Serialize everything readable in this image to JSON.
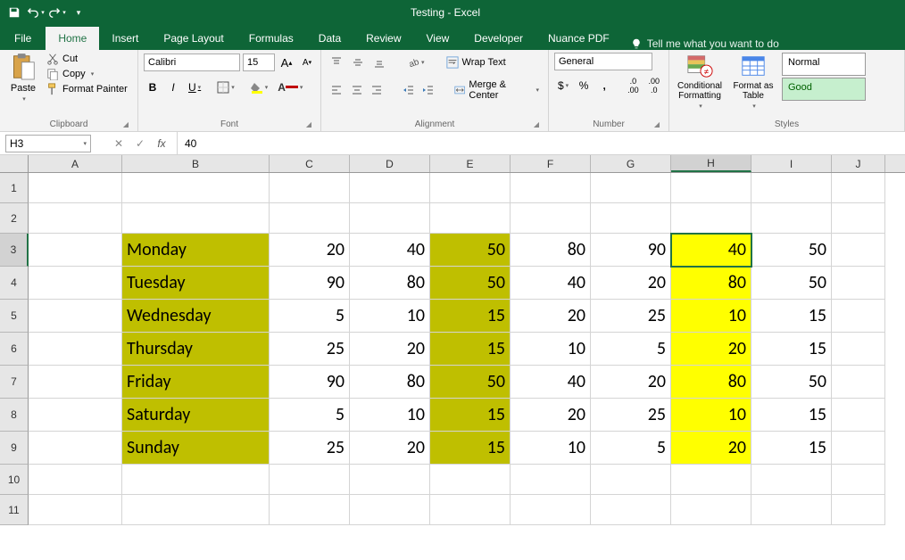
{
  "title": "Testing  -  Excel",
  "qat": {
    "save": "save-icon",
    "undo": "undo-icon",
    "redo": "redo-icon"
  },
  "tabs": [
    "File",
    "Home",
    "Insert",
    "Page Layout",
    "Formulas",
    "Data",
    "Review",
    "View",
    "Developer",
    "Nuance PDF"
  ],
  "active_tab": "Home",
  "tell_me": "Tell me what you want to do",
  "ribbon": {
    "clipboard": {
      "label": "Clipboard",
      "paste": "Paste",
      "cut": "Cut",
      "copy": "Copy",
      "format_painter": "Format Painter"
    },
    "font": {
      "label": "Font",
      "name": "Calibri",
      "size": "15",
      "bold": "B",
      "italic": "I",
      "underline": "U"
    },
    "alignment": {
      "label": "Alignment",
      "wrap": "Wrap Text",
      "merge": "Merge & Center"
    },
    "number": {
      "label": "Number",
      "format": "General"
    },
    "styles": {
      "label": "Styles",
      "conditional": "Conditional Formatting",
      "format_table": "Format as Table",
      "normal": "Normal",
      "good": "Good"
    }
  },
  "formula_bar": {
    "cell_ref": "H3",
    "value": "40"
  },
  "columns": [
    "A",
    "B",
    "C",
    "D",
    "E",
    "F",
    "G",
    "H",
    "I",
    "J"
  ],
  "selected_col": "H",
  "selected_row": 3,
  "rows": [
    1,
    2,
    3,
    4,
    5,
    6,
    7,
    8,
    9,
    10,
    11
  ],
  "data": {
    "B3": "Monday",
    "C3": "20",
    "D3": "40",
    "E3": "50",
    "F3": "80",
    "G3": "90",
    "H3": "40",
    "I3": "50",
    "B4": "Tuesday",
    "C4": "90",
    "D4": "80",
    "E4": "50",
    "F4": "40",
    "G4": "20",
    "H4": "80",
    "I4": "50",
    "B5": "Wednesday",
    "C5": "5",
    "D5": "10",
    "E5": "15",
    "F5": "20",
    "G5": "25",
    "H5": "10",
    "I5": "15",
    "B6": "Thursday",
    "C6": "25",
    "D6": "20",
    "E6": "15",
    "F6": "10",
    "G6": "5",
    "H6": "20",
    "I6": "15",
    "B7": "Friday",
    "C7": "90",
    "D7": "80",
    "E7": "50",
    "F7": "40",
    "G7": "20",
    "H7": "80",
    "I7": "50",
    "B8": "Saturday",
    "C8": "5",
    "D8": "10",
    "E8": "15",
    "F8": "20",
    "G8": "25",
    "H8": "10",
    "I8": "15",
    "B9": "Sunday",
    "C9": "25",
    "D9": "20",
    "E9": "15",
    "F9": "10",
    "G9": "5",
    "H9": "20",
    "I9": "15"
  },
  "olive_cells": [
    "B3",
    "B4",
    "B5",
    "B6",
    "B7",
    "B8",
    "B9",
    "E3",
    "E4",
    "E5",
    "E6",
    "E7",
    "E8",
    "E9"
  ],
  "yellow_cells": [
    "H3",
    "H4",
    "H5",
    "H6",
    "H7",
    "H8",
    "H9"
  ],
  "active_cell": "H3"
}
